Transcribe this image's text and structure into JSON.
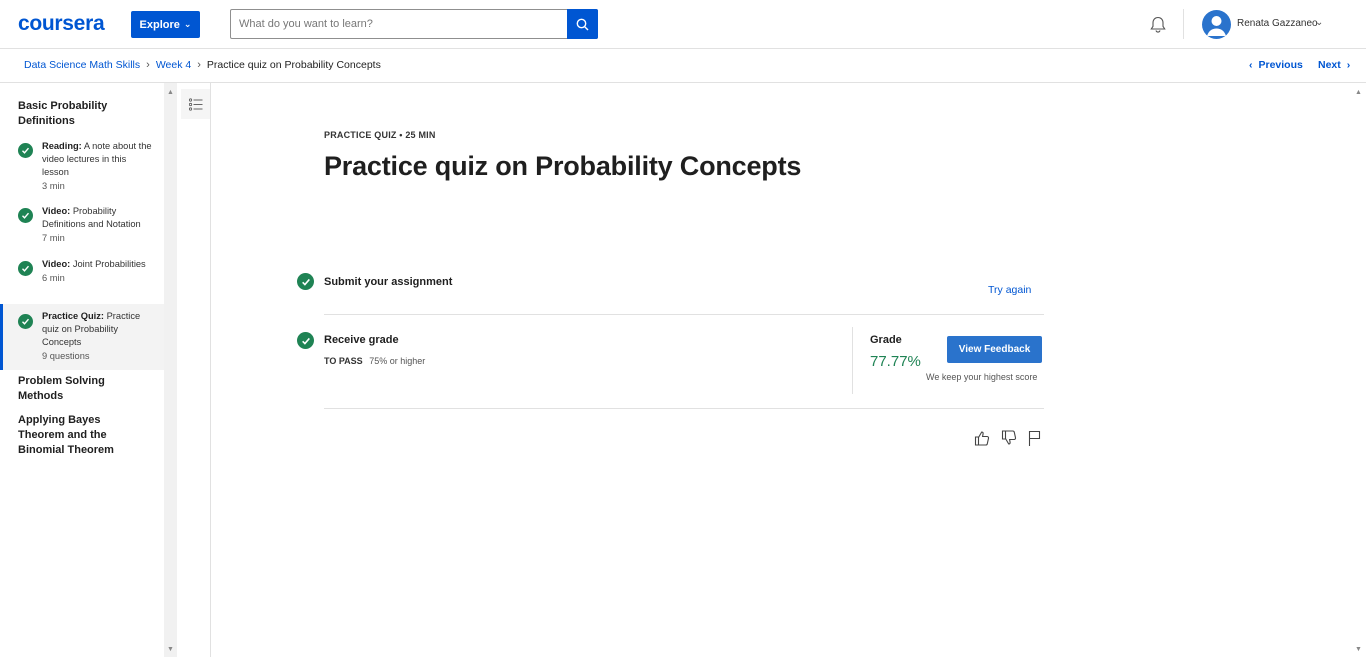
{
  "header": {
    "logo": "coursera",
    "explore_label": "Explore",
    "search_placeholder": "What do you want to learn?",
    "user_name": "Renata Gazzaneo"
  },
  "breadcrumb": {
    "items": [
      "Data Science Math Skills",
      "Week 4"
    ],
    "current": "Practice quiz on Probability Concepts",
    "previous_label": "Previous",
    "next_label": "Next"
  },
  "sidebar": {
    "sections": [
      {
        "title": "Basic Probability Definitions",
        "items": [
          {
            "type": "Reading:",
            "text": "A note about the video lectures in this lesson",
            "meta": "3 min",
            "completed": true,
            "active": false
          },
          {
            "type": "Video:",
            "text": "Probability Definitions and Notation",
            "meta": "7 min",
            "completed": true,
            "active": false
          },
          {
            "type": "Video:",
            "text": "Joint Probabilities",
            "meta": "6 min",
            "completed": true,
            "active": false
          },
          {
            "type": "Practice Quiz:",
            "text": "Practice quiz on Probability Concepts",
            "meta": "9 questions",
            "completed": true,
            "active": true
          }
        ]
      },
      {
        "title": "Problem Solving Methods",
        "items": []
      },
      {
        "title": "Applying Bayes Theorem and the Binomial Theorem",
        "items": []
      }
    ]
  },
  "main": {
    "eyebrow": "PRACTICE QUIZ • 25 MIN",
    "title": "Practice quiz on Probability Concepts",
    "submit": {
      "label": "Submit your assignment",
      "action": "Try again"
    },
    "receive": {
      "label": "Receive grade",
      "to_pass_label": "TO PASS",
      "to_pass_value": "75% or higher",
      "grade_label": "Grade",
      "grade_value": "77.77%",
      "feedback_button": "View Feedback",
      "note": "We keep your highest score"
    }
  },
  "colors": {
    "brand": "#0056d2",
    "success": "#1f8354",
    "button": "#2a73cc"
  }
}
